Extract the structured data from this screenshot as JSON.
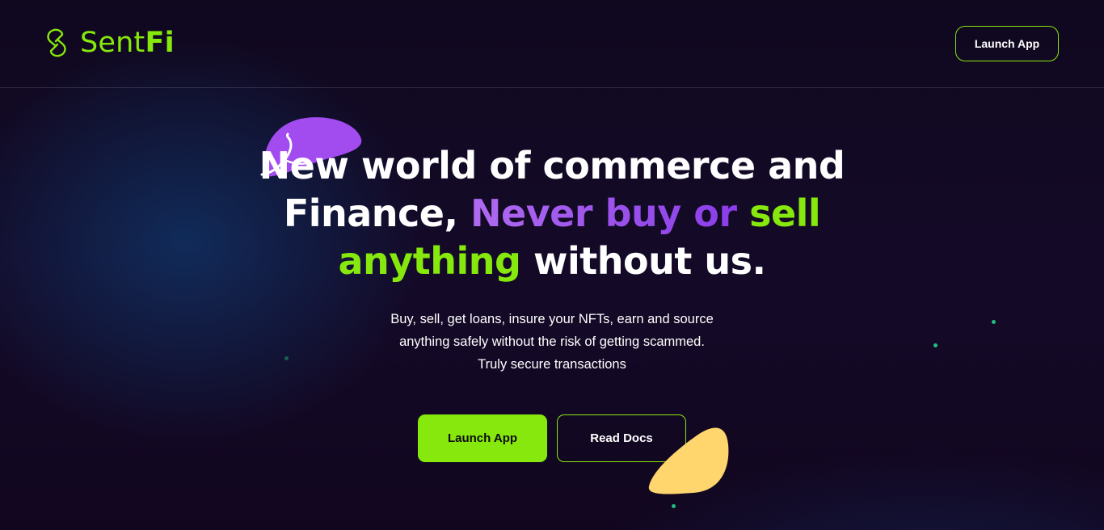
{
  "header": {
    "logo": {
      "prefix": "Sent",
      "suffix": "Fi",
      "icon": "chain-link-logo-icon"
    },
    "launch_label": "Launch App"
  },
  "hero": {
    "headline": {
      "part1": "New world of commerce and Finance,",
      "part2": "Never buy or",
      "part3": "sell anything",
      "part4": "without us."
    },
    "subtitle": {
      "line1": "Buy, sell, get loans, insure your NFTs, earn and source",
      "line2": "anything safely without the risk of getting scammed.",
      "line3": "Truly secure transactions"
    },
    "primary_label": "Launch App",
    "secondary_label": "Read Docs"
  },
  "colors": {
    "accent": "#86e80c",
    "purple": "#a24cf0",
    "yellow": "#ffd56e",
    "background": "#12061f",
    "dots": "#1fbf7f"
  }
}
